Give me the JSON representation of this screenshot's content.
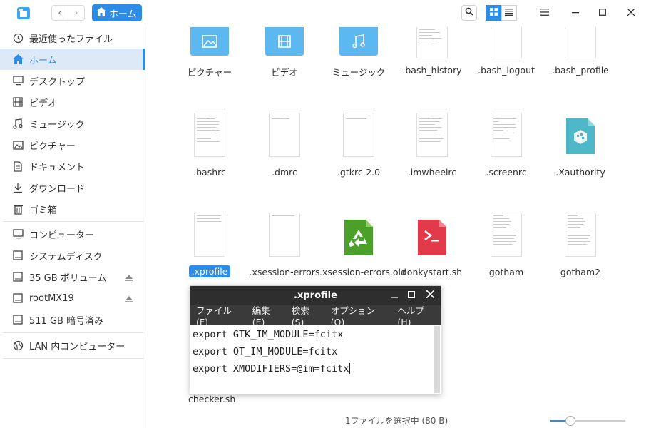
{
  "header": {
    "breadcrumb_label": "ホーム"
  },
  "sidebar": {
    "items": [
      {
        "label": "最近使ったファイル"
      },
      {
        "label": "ホーム"
      },
      {
        "label": "デスクトップ"
      },
      {
        "label": "ビデオ"
      },
      {
        "label": "ミュージック"
      },
      {
        "label": "ピクチャー"
      },
      {
        "label": "ドキュメント"
      },
      {
        "label": "ダウンロード"
      },
      {
        "label": "ゴミ箱"
      },
      {
        "label": "コンピューター"
      },
      {
        "label": "システムディスク"
      },
      {
        "label": "35 GB ボリューム"
      },
      {
        "label": "rootMX19"
      },
      {
        "label": "511 GB 暗号済み"
      },
      {
        "label": "LAN 内コンピューター"
      }
    ]
  },
  "files": {
    "row1": [
      ".bash_history",
      ".bash_logout",
      ".bash_profile"
    ],
    "folders": [
      "ピクチャー",
      "ビデオ",
      "ミュージック"
    ],
    "row2": [
      ".bashrc",
      ".dmrc",
      ".gtkrc-2.0",
      ".imwheelrc",
      ".screenrc",
      ".Xauthority"
    ],
    "row3": [
      ".xprofile",
      ".xsession-errors",
      ".xsession-errors.old",
      "conkystart.sh",
      "gotham",
      "gotham2"
    ],
    "row4_partial": "checker.sh"
  },
  "status": {
    "selection_text": "1ファイルを選択中 (80 B)",
    "zoom_fraction": 0.27
  },
  "editor": {
    "title": ".xprofile",
    "menu": [
      "ファイル(F)",
      "編集(E)",
      "検索(S)",
      "オプション(O)",
      "ヘルプ(H)"
    ],
    "lines": [
      "export GTK_IM_MODULE=fcitx",
      "export QT_IM_MODULE=fcitx",
      "export XMODIFIERS=@im=fcitx"
    ]
  },
  "colors": {
    "accent": "#2c8ce8",
    "folder": "#5bb8f0",
    "editor_titlebar": "#2e2e2e"
  }
}
